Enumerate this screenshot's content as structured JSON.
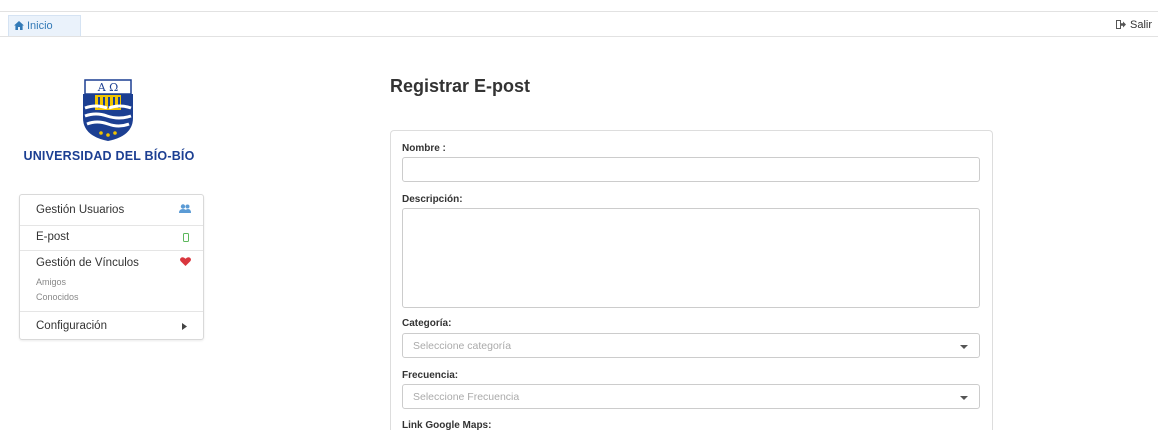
{
  "topbar": {
    "home_label": "Inicio",
    "home_icon": "home-icon",
    "logout_label": "Salir",
    "logout_icon": "logout-icon"
  },
  "branding": {
    "university_name": "UNIVERSIDAD DEL BÍO-BÍO",
    "logo_icon": "university-crest-icon",
    "logo_letters": "A Ω",
    "colors": {
      "navy": "#1c3f92",
      "gold": "#f0c400",
      "red": "#c8102e"
    }
  },
  "sidebar": {
    "items": [
      {
        "label": "Gestión Usuarios",
        "icon": "users-icon",
        "icon_color": "#5b9bd5"
      },
      {
        "label": "E-post",
        "icon": "mobile-icon",
        "icon_color": "#5cb85c"
      },
      {
        "label": "Gestión de Vínculos",
        "icon": "heart-icon",
        "icon_color": "#d9363e",
        "children": [
          "Amigos",
          "Conocidos"
        ]
      },
      {
        "label": "Configuración",
        "icon": "caret-right-icon"
      }
    ]
  },
  "page": {
    "title": "Registrar E-post"
  },
  "form": {
    "nombre_label": "Nombre :",
    "nombre_value": "",
    "descripcion_label": "Descripción:",
    "descripcion_value": "",
    "categoria_label": "Categoría:",
    "categoria_placeholder": "Seleccione categoría",
    "frecuencia_label": "Frecuencia:",
    "frecuencia_placeholder": "Seleccione Frecuencia",
    "link_label": "Link Google Maps:"
  }
}
